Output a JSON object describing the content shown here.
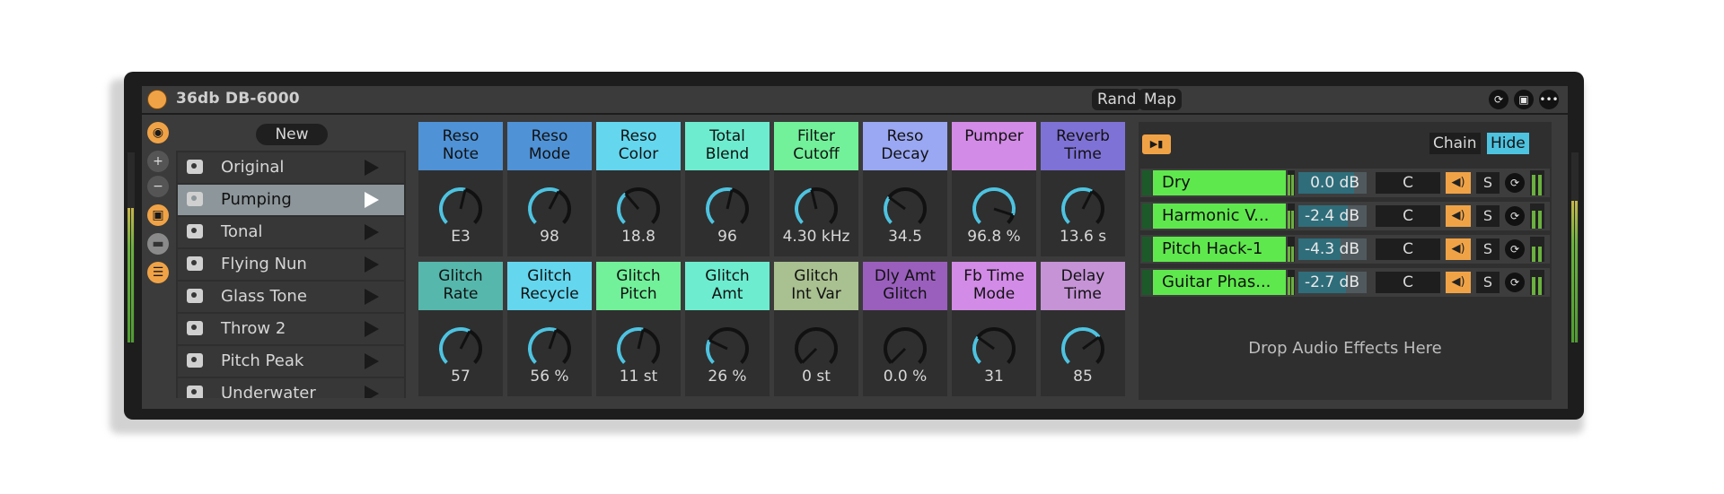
{
  "device": {
    "title": "36db DB-6000",
    "rand_label": "Rand",
    "map_label": "Map",
    "colors": {
      "accent": "#f0a346",
      "panel": "#3b3b3b",
      "knob_arc": "#4ec3e0"
    }
  },
  "presets": {
    "new_label": "New",
    "items": [
      {
        "label": "Original",
        "selected": false
      },
      {
        "label": "Pumping",
        "selected": true
      },
      {
        "label": "Tonal",
        "selected": false
      },
      {
        "label": "Flying Nun",
        "selected": false
      },
      {
        "label": "Glass Tone",
        "selected": false
      },
      {
        "label": "Throw 2",
        "selected": false
      },
      {
        "label": "Pitch Peak",
        "selected": false
      },
      {
        "label": "Underwater",
        "selected": false
      }
    ]
  },
  "macros": [
    {
      "label": "Reso\nNote",
      "value": "E3",
      "color": "#4f92d6",
      "level": 0.55
    },
    {
      "label": "Reso\nMode",
      "value": "98",
      "color": "#4f92d6",
      "level": 0.6
    },
    {
      "label": "Reso\nColor",
      "value": "18.8",
      "color": "#64d6ee",
      "level": 0.35
    },
    {
      "label": "Total\nBlend",
      "value": "96",
      "color": "#6deccf",
      "level": 0.55
    },
    {
      "label": "Filter\nCutoff",
      "value": "4.30 kHz",
      "color": "#72f09a",
      "level": 0.45
    },
    {
      "label": "Reso\nDecay",
      "value": "34.5",
      "color": "#9aa7f2",
      "level": 0.3
    },
    {
      "label": "Pumper",
      "value": "96.8 %",
      "color": "#d28be6",
      "level": 0.9
    },
    {
      "label": "Reverb\nTime",
      "value": "13.6 s",
      "color": "#7f72d6",
      "level": 0.6
    },
    {
      "label": "Glitch\nRate",
      "value": "57",
      "color": "#56b7ac",
      "level": 0.6
    },
    {
      "label": "Glitch\nRecycle",
      "value": "56 %",
      "color": "#64d6ee",
      "level": 0.57
    },
    {
      "label": "Glitch\nPitch",
      "value": "11 st",
      "color": "#72f09a",
      "level": 0.55
    },
    {
      "label": "Glitch\nAmt",
      "value": "26 %",
      "color": "#6deccf",
      "level": 0.26
    },
    {
      "label": "Glitch\nInt Var",
      "value": "0 st",
      "color": "#a9c090",
      "level": 0.0
    },
    {
      "label": "Dly Amt\nGlitch",
      "value": "0.0 %",
      "color": "#9a5fbd",
      "level": 0.0
    },
    {
      "label": "Fb Time\nMode",
      "value": "31",
      "color": "#d28be6",
      "level": 0.3
    },
    {
      "label": "Delay\nTime",
      "value": "85",
      "color": "#c593d6",
      "level": 0.7
    }
  ],
  "chain": {
    "chain_label": "Chain",
    "hide_label": "Hide",
    "rows": [
      {
        "name": "Dry",
        "volume": "0.0 dB",
        "pan": "C",
        "solo": "S",
        "level": 0.82
      },
      {
        "name": "Harmonic V...",
        "volume": "-2.4 dB",
        "pan": "C",
        "solo": "S",
        "level": 0.72
      },
      {
        "name": "Pitch Hack-1",
        "volume": "-4.3 dB",
        "pan": "C",
        "solo": "S",
        "level": 0.62
      },
      {
        "name": "Guitar Phas...",
        "volume": "-2.7 dB",
        "pan": "C",
        "solo": "S",
        "level": 0.7
      }
    ],
    "drop_text": "Drop Audio Effects Here"
  }
}
